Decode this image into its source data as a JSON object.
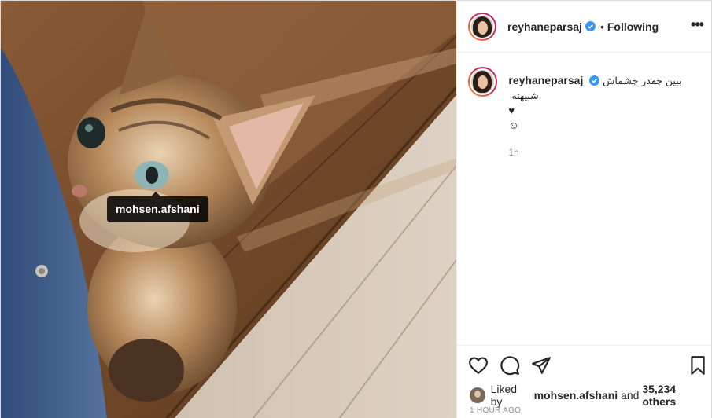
{
  "photo": {
    "tag_username": "mohsen.afshani"
  },
  "header": {
    "username": "reyhaneparsaj",
    "separator": "•",
    "follow_status": "Following",
    "more_glyph": "•••"
  },
  "caption": {
    "username": "reyhaneparsaj",
    "text": "ببین چقدر چشماش شبیهته",
    "line2": "♥",
    "line3": "☺",
    "time": "1h"
  },
  "actions": {
    "like_icon": "heart-icon",
    "comment_icon": "comment-icon",
    "share_icon": "paper-plane-icon",
    "save_icon": "bookmark-icon"
  },
  "likes": {
    "prefix": "Liked by",
    "user": "mohsen.afshani",
    "middle": "and",
    "others": "35,234 others"
  },
  "timestamp": "1 HOUR AGO",
  "colors": {
    "verified": "#3897f0",
    "muted": "#8e8e8e",
    "text": "#262626"
  }
}
